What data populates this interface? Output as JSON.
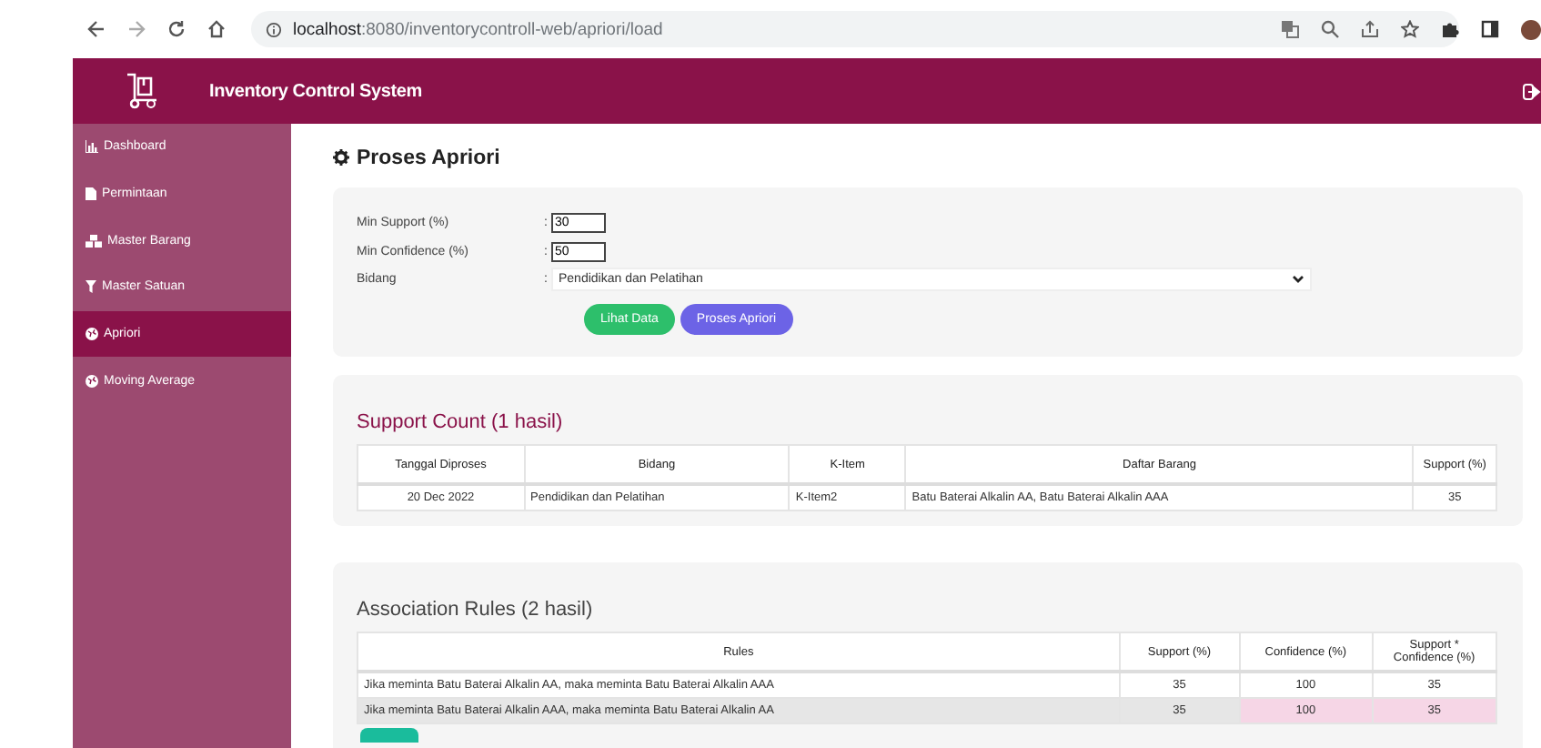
{
  "browser": {
    "url_host": "localhost",
    "url_rest": ":8080/inventorycontroll-web/apriori/load"
  },
  "app": {
    "title": "Inventory Control System"
  },
  "sidebar": {
    "items": [
      {
        "label": "Dashboard",
        "kind": "chart",
        "selected": false
      },
      {
        "label": "Permintaan",
        "kind": "file",
        "selected": false
      },
      {
        "label": "Master Barang",
        "kind": "cubes",
        "selected": false
      },
      {
        "label": "Master Satuan",
        "kind": "filter",
        "selected": false
      },
      {
        "label": "Apriori",
        "kind": "globe",
        "selected": true
      },
      {
        "label": "Moving Average",
        "kind": "globe",
        "selected": false
      }
    ]
  },
  "page_title": "Proses Apriori",
  "form": {
    "fields": [
      {
        "label": "Min Support (%)",
        "separator": ":",
        "kind": "input",
        "value": "30"
      },
      {
        "label": "Min Confidence (%)",
        "separator": ":",
        "kind": "input",
        "value": "50"
      },
      {
        "label": "Bidang",
        "separator": ":",
        "kind": "select",
        "value": "Pendidikan dan Pelatihan"
      }
    ],
    "buttons": [
      {
        "label": "Lihat Data",
        "kind": "green"
      },
      {
        "label": "Proses Apriori",
        "kind": "purple"
      }
    ]
  },
  "support_count": {
    "title": "Support Count (1 hasil)",
    "columns": [
      "Tanggal Diproses",
      "Bidang",
      "K-Item",
      "Daftar Barang",
      "Support (%)"
    ],
    "rows": [
      [
        "20 Dec 2022",
        "Pendidikan dan Pelatihan",
        "K-Item2",
        "Batu Baterai Alkalin AA, Batu Baterai Alkalin AAA",
        "35"
      ]
    ]
  },
  "association_rules": {
    "title": "Association Rules (2 hasil)",
    "columns": [
      "Rules",
      "Support (%)",
      "Confidence (%)",
      "Support * Confidence (%)"
    ],
    "rows": [
      {
        "cells": [
          "Jika meminta Batu Baterai Alkalin AA, maka meminta Batu Baterai Alkalin AAA",
          "35",
          "100",
          "35"
        ],
        "highlighted": false
      },
      {
        "cells": [
          "Jika meminta Batu Baterai Alkalin AAA, maka meminta Batu Baterai Alkalin AA",
          "35",
          "100",
          "35"
        ],
        "highlighted": true
      }
    ]
  }
}
